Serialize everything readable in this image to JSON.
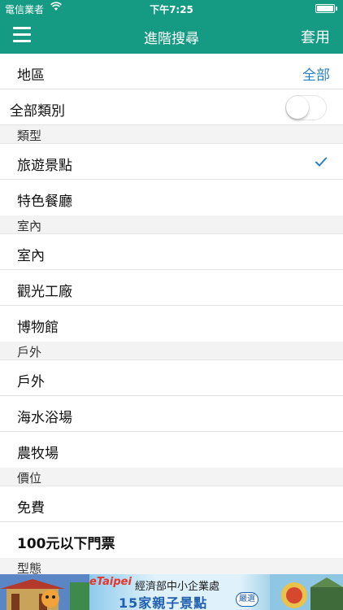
{
  "status_bar": {
    "carrier": "電信業者",
    "time": "下午7:25",
    "wifi_icon": "wifi-icon",
    "battery_icon": "battery-icon"
  },
  "nav": {
    "menu_icon": "hamburger-menu-icon",
    "title": "進階搜尋",
    "apply_label": "套用",
    "color": "#159a84"
  },
  "region": {
    "label": "地區",
    "value": "全部"
  },
  "all_categories": {
    "label": "全部類別",
    "on": false
  },
  "sections": [
    {
      "title": "類型",
      "items": [
        {
          "label": "旅遊景點",
          "checked": true
        },
        {
          "label": "特色餐廳",
          "checked": false
        }
      ]
    },
    {
      "title": "室內",
      "items": [
        {
          "label": "室內",
          "checked": false
        },
        {
          "label": "觀光工廠",
          "checked": false
        },
        {
          "label": "博物館",
          "checked": false
        }
      ]
    },
    {
      "title": "戶外",
      "items": [
        {
          "label": "戶外",
          "checked": false
        },
        {
          "label": "海水浴場",
          "checked": false
        },
        {
          "label": "農牧場",
          "checked": false
        }
      ]
    },
    {
      "title": "價位",
      "items": [
        {
          "label": "免費",
          "checked": false
        },
        {
          "label": "100元以下門票",
          "checked": false
        }
      ]
    },
    {
      "title": "型態",
      "items": []
    }
  ],
  "banner": {
    "logo": "eTaipei",
    "agency": "經濟部中小企業處",
    "headline": "15家親子景點",
    "badge": "嚴選"
  },
  "accent_color": "#2a7fbf"
}
